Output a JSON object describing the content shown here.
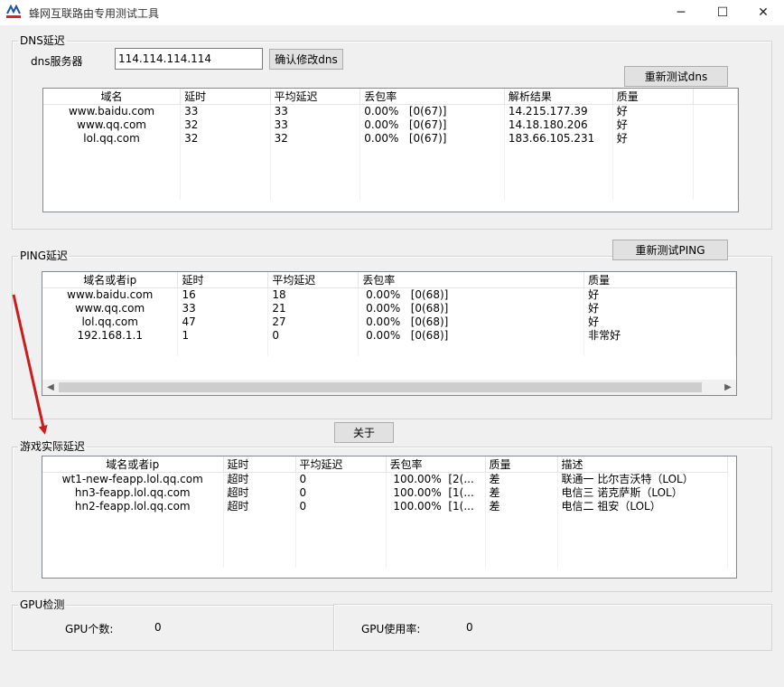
{
  "window": {
    "title": "蜂网互联路由专用测试工具",
    "min": "─",
    "max": "☐",
    "close": "✕"
  },
  "dns": {
    "legend": "DNS延迟",
    "server_label": "dns服务器",
    "server_value": "114.114.114.114",
    "confirm_button": "确认修改dns",
    "retest_button": "重新测试dns",
    "columns": [
      "域名",
      "延时",
      "平均延迟",
      "丢包率",
      "解析结果",
      "质量"
    ],
    "rows": [
      {
        "domain": "www.baidu.com",
        "delay": "33",
        "avg": "33",
        "loss": "0.00%",
        "loss_detail": "[0(67)]",
        "result": "14.215.177.39",
        "quality": "好"
      },
      {
        "domain": "www.qq.com",
        "delay": "32",
        "avg": "33",
        "loss": "0.00%",
        "loss_detail": "[0(67)]",
        "result": "14.18.180.206",
        "quality": "好"
      },
      {
        "domain": "lol.qq.com",
        "delay": "32",
        "avg": "32",
        "loss": "0.00%",
        "loss_detail": "[0(67)]",
        "result": "183.66.105.231",
        "quality": "好"
      }
    ]
  },
  "ping": {
    "legend": "PING延迟",
    "retest_button": "重新测试PING",
    "columns": [
      "域名或者ip",
      "延时",
      "平均延迟",
      "丢包率",
      "质量"
    ],
    "rows": [
      {
        "host": "www.baidu.com",
        "delay": "16",
        "avg": "18",
        "loss": "0.00%",
        "loss_detail": "[0(68)]",
        "quality": "好"
      },
      {
        "host": "www.qq.com",
        "delay": "33",
        "avg": "21",
        "loss": "0.00%",
        "loss_detail": "[0(68)]",
        "quality": "好"
      },
      {
        "host": "lol.qq.com",
        "delay": "47",
        "avg": "27",
        "loss": "0.00%",
        "loss_detail": "[0(68)]",
        "quality": "好"
      },
      {
        "host": "192.168.1.1",
        "delay": "1",
        "avg": "0",
        "loss": "0.00%",
        "loss_detail": "[0(68)]",
        "quality": "非常好"
      }
    ],
    "scroll_left": "◀",
    "scroll_right": "▶"
  },
  "about_button": "关于",
  "game": {
    "legend": "游戏实际延迟",
    "columns": [
      "域名或者ip",
      "延时",
      "平均延迟",
      "丢包率",
      "质量",
      "描述"
    ],
    "rows": [
      {
        "host": "wt1-new-feapp.lol.qq.com",
        "delay": "超时",
        "avg": "0",
        "loss": "100.00%",
        "loss_detail": "[2(...",
        "quality": "差",
        "desc": "联通一 比尔吉沃特（LOL）"
      },
      {
        "host": "hn3-feapp.lol.qq.com",
        "delay": "超时",
        "avg": "0",
        "loss": "100.00%",
        "loss_detail": "[1(...",
        "quality": "差",
        "desc": "电信三 诺克萨斯（LOL）"
      },
      {
        "host": "hn2-feapp.lol.qq.com",
        "delay": "超时",
        "avg": "0",
        "loss": "100.00%",
        "loss_detail": "[1(...",
        "quality": "差",
        "desc": "电信二 祖安（LOL）"
      }
    ]
  },
  "gpu": {
    "legend": "GPU检测",
    "count_label": "GPU个数:",
    "count_value": "0",
    "usage_label": "GPU使用率:",
    "usage_value": "0"
  },
  "colors": {
    "arrow": "#c81e1e",
    "logo_blue": "#1f4fa8",
    "logo_red": "#e02020"
  }
}
